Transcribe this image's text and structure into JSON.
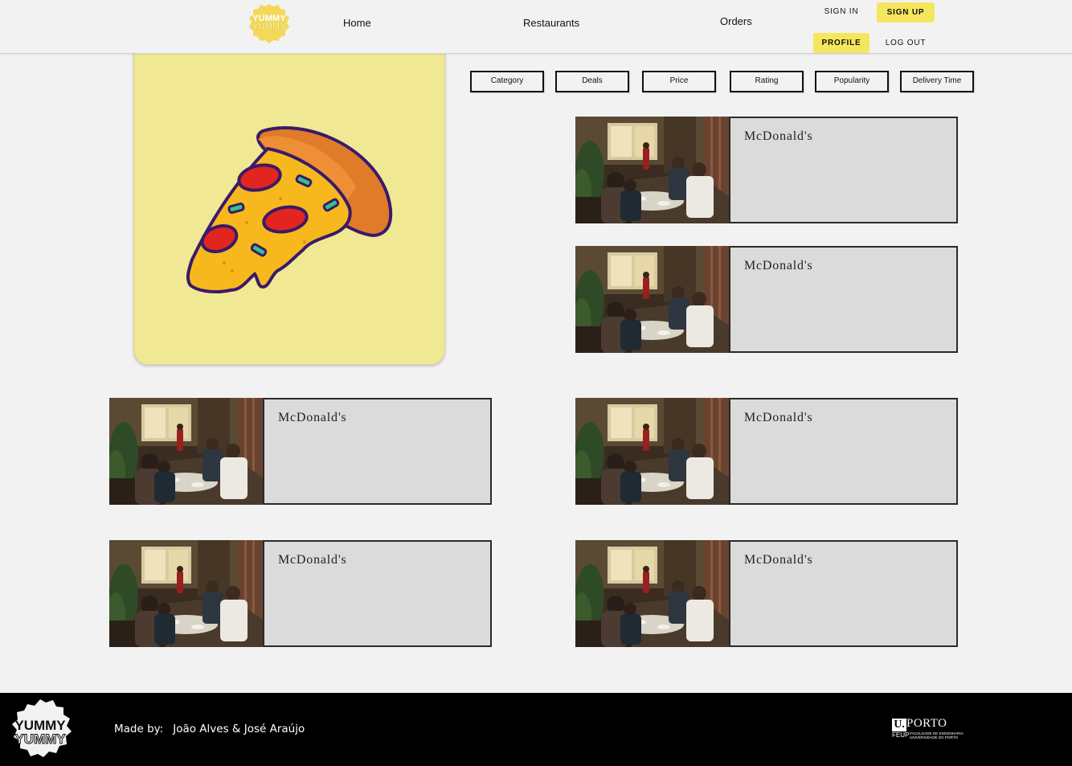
{
  "header": {
    "logo": {
      "line1": "YUMMY",
      "line2": "YUMMY"
    },
    "nav": {
      "home": "Home",
      "restaurants": "Restaurants",
      "orders": "Orders"
    },
    "auth": {
      "sign_in": "SIGN IN",
      "sign_up": "SIGN UP",
      "profile": "PROFILE",
      "log_out": "LOG OUT"
    }
  },
  "colors": {
    "accent": "#f5e75d",
    "hero_bg": "#f1e893",
    "card_bg": "#dcdbdc",
    "footer_bg": "#000000"
  },
  "hero": {
    "icon": "pizza-slice-icon"
  },
  "filters": [
    "Category",
    "Deals",
    "Price",
    "Rating",
    "Popularity",
    "Delivery Time"
  ],
  "restaurants": [
    {
      "name": "McDonald's",
      "image": "restaurant-dining-photo"
    },
    {
      "name": "McDonald's",
      "image": "restaurant-dining-photo"
    },
    {
      "name": "McDonald's",
      "image": "restaurant-dining-photo"
    },
    {
      "name": "McDonald's",
      "image": "restaurant-dining-photo"
    },
    {
      "name": "McDonald's",
      "image": "restaurant-dining-photo"
    },
    {
      "name": "McDonald's",
      "image": "restaurant-dining-photo"
    }
  ],
  "footer": {
    "logo": {
      "line1": "YUMMY",
      "line2": "YUMMY"
    },
    "made_by_label": "Made by:",
    "authors": "João Alves & José Araújo",
    "university": {
      "u": "U.",
      "word": "PORTO",
      "feup": "FEUP",
      "faculty_line1": "FACULDADE DE ENGENHARIA",
      "faculty_line2": "UNIVERSIDADE DO PORTO"
    }
  }
}
